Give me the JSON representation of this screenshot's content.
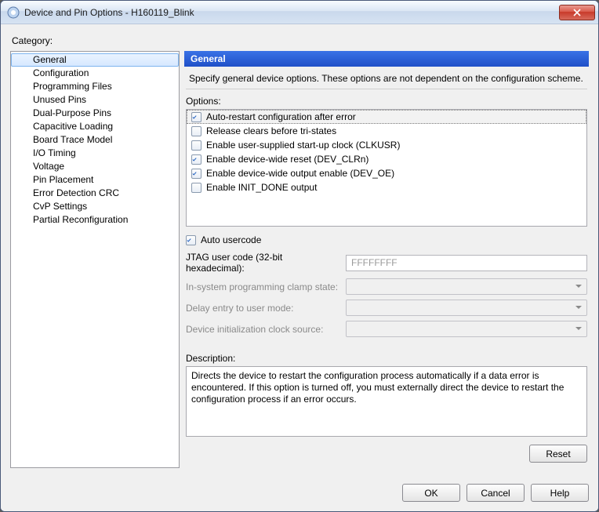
{
  "window": {
    "title": "Device and Pin Options - H160119_Blink"
  },
  "category_label": "Category:",
  "categories": [
    "General",
    "Configuration",
    "Programming Files",
    "Unused Pins",
    "Dual-Purpose Pins",
    "Capacitive Loading",
    "Board Trace Model",
    "I/O Timing",
    "Voltage",
    "Pin Placement",
    "Error Detection CRC",
    "CvP Settings",
    "Partial Reconfiguration"
  ],
  "selected_category_index": 0,
  "panel": {
    "header": "General",
    "description": "Specify general device options. These options are not dependent on the configuration scheme.",
    "options_label": "Options:",
    "options": [
      {
        "label": "Auto-restart configuration after error",
        "checked": true,
        "selected": true
      },
      {
        "label": "Release clears before tri-states",
        "checked": false,
        "selected": false
      },
      {
        "label": "Enable user-supplied start-up clock (CLKUSR)",
        "checked": false,
        "selected": false
      },
      {
        "label": "Enable device-wide reset (DEV_CLRn)",
        "checked": true,
        "selected": false
      },
      {
        "label": "Enable device-wide output enable (DEV_OE)",
        "checked": true,
        "selected": false
      },
      {
        "label": "Enable INIT_DONE output",
        "checked": false,
        "selected": false
      }
    ],
    "auto_usercode": {
      "label": "Auto usercode",
      "checked": true
    },
    "jtag": {
      "label": "JTAG user code (32-bit hexadecimal):",
      "value": "FFFFFFFF",
      "enabled": false
    },
    "clamp": {
      "label": "In-system programming clamp state:",
      "enabled": false
    },
    "delay": {
      "label": "Delay entry to user mode:",
      "enabled": false
    },
    "initclk": {
      "label": "Device initialization clock source:",
      "enabled": false
    },
    "description_label": "Description:",
    "description_text": "Directs the device to restart the configuration process automatically if a data error is encountered. If this option is turned off, you must externally direct the device to restart the configuration process if an error occurs.",
    "reset_label": "Reset"
  },
  "footer": {
    "ok": "OK",
    "cancel": "Cancel",
    "help": "Help"
  }
}
